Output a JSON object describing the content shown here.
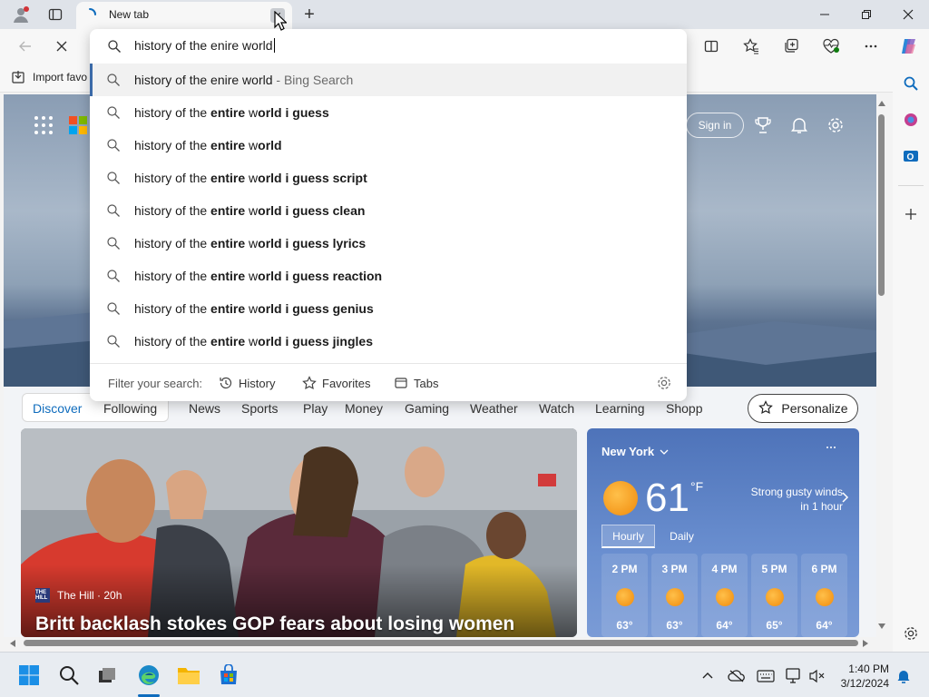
{
  "browser": {
    "tab_title": "New tab",
    "tab_close_icon": "close-icon",
    "new_tab_icon": "plus-icon"
  },
  "toolbar": {
    "stop_icon": "close-icon",
    "import_favorites_label": "Import favo"
  },
  "omnibox": {
    "value": "history of the enire world",
    "suggestions": [
      {
        "plain": "history of the enire world",
        "suffix": " - Bing Search"
      },
      {
        "prefix": "history of the ",
        "bold1": "entire",
        "mid": " w",
        "bold2": "orld i guess"
      },
      {
        "prefix": "history of the ",
        "bold1": "entire",
        "mid": " w",
        "bold2": "orld"
      },
      {
        "prefix": "history of the ",
        "bold1": "entire",
        "mid": " w",
        "bold2": "orld i guess script"
      },
      {
        "prefix": "history of the ",
        "bold1": "entire",
        "mid": " w",
        "bold2": "orld i guess clean"
      },
      {
        "prefix": "history of the ",
        "bold1": "entire",
        "mid": " w",
        "bold2": "orld i guess lyrics"
      },
      {
        "prefix": "history of the ",
        "bold1": "entire",
        "mid": " w",
        "bold2": "orld i guess reaction"
      },
      {
        "prefix": "history of the ",
        "bold1": "entire",
        "mid": " w",
        "bold2": "orld i guess genius"
      },
      {
        "prefix": "history of the ",
        "bold1": "entire",
        "mid": " w",
        "bold2": "orld i guess jingles"
      }
    ],
    "filter_label": "Filter your search:",
    "filters": [
      "History",
      "Favorites",
      "Tabs"
    ]
  },
  "newtab": {
    "sign_in_label": "Sign in",
    "nav_tabs": [
      "Discover",
      "Following",
      "News",
      "Sports",
      "Play",
      "Money",
      "Gaming",
      "Weather",
      "Watch",
      "Learning",
      "Shopp"
    ],
    "personalize_label": "Personalize",
    "news": {
      "source_logo": "THE HILL",
      "source": "The Hill · 20h",
      "headline": "Britt backlash stokes GOP fears about losing women"
    },
    "weather": {
      "city": "New York",
      "temp": "61",
      "unit": "°F",
      "alert_line1": "Strong gusty winds",
      "alert_line2": "in 1 hour",
      "tabs": [
        "Hourly",
        "Daily"
      ],
      "hours": [
        {
          "time": "2 PM",
          "temp": "63°"
        },
        {
          "time": "3 PM",
          "temp": "63°"
        },
        {
          "time": "4 PM",
          "temp": "64°"
        },
        {
          "time": "5 PM",
          "temp": "65°"
        },
        {
          "time": "6 PM",
          "temp": "64°"
        }
      ]
    }
  },
  "taskbar": {
    "time": "1:40 PM",
    "date": "3/12/2024"
  },
  "colors": {
    "accent": "#0f6cbd",
    "highlight_bar": "#3b6aa8",
    "weather_card": "#4e73b9"
  }
}
